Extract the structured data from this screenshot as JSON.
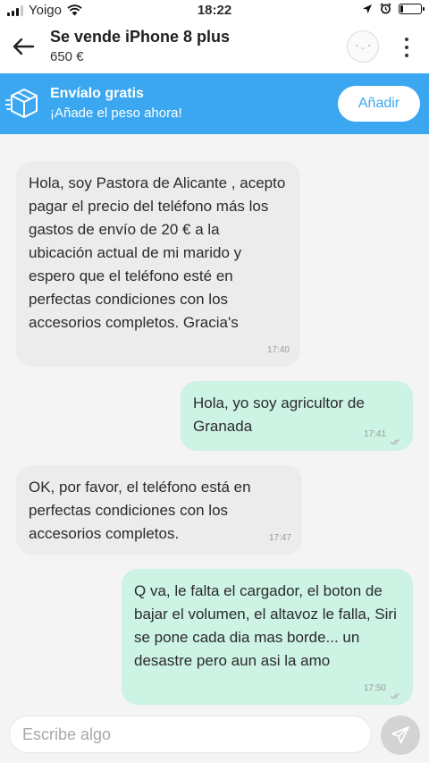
{
  "status_bar": {
    "carrier": "Yoigo",
    "time": "18:22",
    "battery_level": 0.15
  },
  "header": {
    "title": "Se vende iPhone 8 plus",
    "price": "650 €",
    "icons": [
      "back-arrow-icon",
      "avatar-icon",
      "more-vertical-icon"
    ]
  },
  "banner": {
    "title": "Envíalo gratis",
    "subtitle": "¡Añade el peso ahora!",
    "button_label": "Añadir",
    "icon": "box-icon",
    "color": "#3aa7f0"
  },
  "messages": [
    {
      "direction": "in",
      "text": "Hola, soy Pastora de Alicante , acepto pagar el precio del teléfono más los gastos de envío de 20 € a la ubicación actual de mi marido y espero que el teléfono esté en perfectas condiciones con los accesorios completos. Gracia's",
      "time": "17:40"
    },
    {
      "direction": "out",
      "text": "Hola, yo soy agricultor de Granada",
      "time": "17:41"
    },
    {
      "direction": "in",
      "text": "OK, por favor, el teléfono está en perfectas condiciones con los accesorios completos.",
      "time": "17:47"
    },
    {
      "direction": "out",
      "text": "Q va, le falta el cargador, el boton de bajar el volumen, el altavoz le falla, Siri se pone cada dia mas borde... un desastre pero aun asi la amo",
      "time": "17:50"
    }
  ],
  "colors": {
    "incoming_bubble": "#ececec",
    "outgoing_bubble": "#ccf3e3"
  },
  "input": {
    "placeholder": "Escribe algo",
    "send_icon": "send-icon"
  }
}
